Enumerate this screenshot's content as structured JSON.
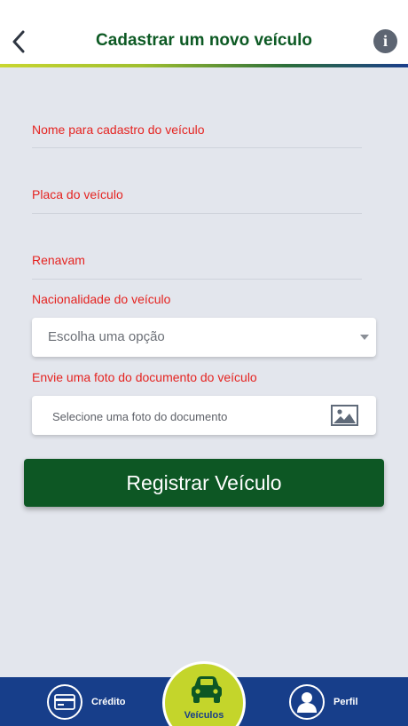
{
  "header": {
    "title": "Cadastrar um novo veículo",
    "info_glyph": "i"
  },
  "form": {
    "name_label": "Nome para cadastro do veículo",
    "plate_label": "Placa do veículo",
    "renavam_label": "Renavam",
    "nationality_label": "Nacionalidade do veículo",
    "nationality_placeholder": "Escolha uma opção",
    "photo_label": "Envie uma foto do documento do veículo",
    "photo_placeholder": "Selecione uma foto do documento",
    "submit_label": "Registrar Veículo"
  },
  "tabbar": {
    "tabs": [
      {
        "label": "Crédito",
        "icon": "credit-card-icon"
      },
      {
        "label": "Veículos",
        "icon": "car-icon",
        "active": true
      },
      {
        "label": "Perfil",
        "icon": "user-icon"
      }
    ]
  },
  "colors": {
    "brand_green": "#0d5724",
    "label_red": "#e52320",
    "tabbar_blue": "#173e8a",
    "active_tab_lime": "#c4d52b"
  }
}
